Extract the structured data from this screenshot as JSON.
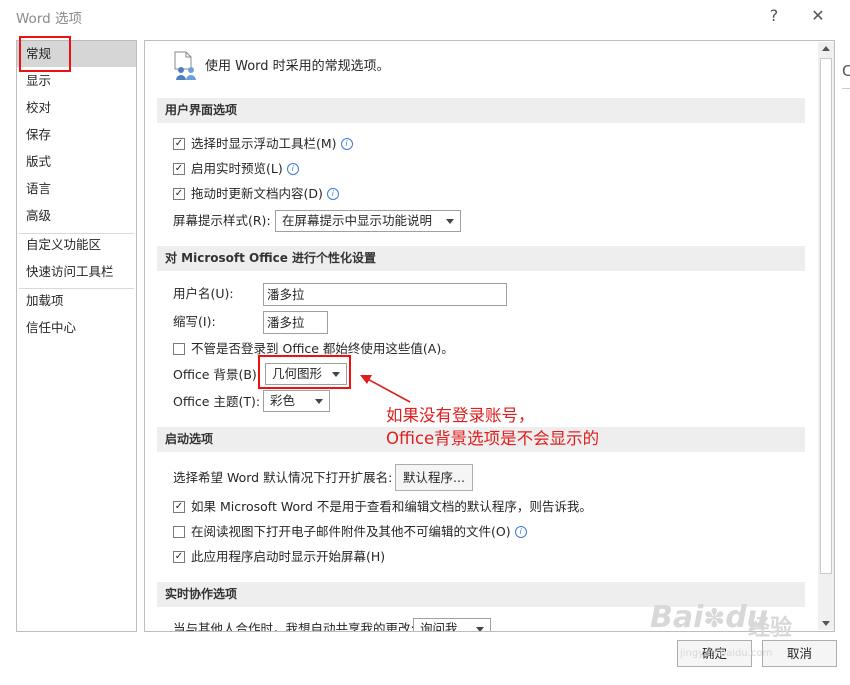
{
  "window": {
    "title": "Word 选项",
    "help_label": "?",
    "close_label": "✕"
  },
  "nav": {
    "items": [
      {
        "label": "常规"
      },
      {
        "label": "显示"
      },
      {
        "label": "校对"
      },
      {
        "label": "保存"
      },
      {
        "label": "版式"
      },
      {
        "label": "语言"
      },
      {
        "label": "高级"
      },
      {
        "label": "自定义功能区"
      },
      {
        "label": "快速访问工具栏"
      },
      {
        "label": "加载项"
      },
      {
        "label": "信任中心"
      }
    ],
    "selected": "常规"
  },
  "header": {
    "title": "使用 Word 时采用的常规选项。",
    "icon": "settings-people-icon"
  },
  "ui_options": {
    "title": "用户界面选项",
    "floating_toolbar": {
      "label": "选择时显示浮动工具栏(M)",
      "checked": true
    },
    "live_preview": {
      "label": "启用实时预览(L)",
      "checked": true
    },
    "update_drag": {
      "label": "拖动时更新文档内容(D)",
      "checked": true
    },
    "screentip_label": "屏幕提示样式(R):",
    "screentip_value": "在屏幕提示中显示功能说明"
  },
  "personalize": {
    "title": "对 Microsoft Office 进行个性化设置",
    "username_label": "用户名(U):",
    "username_value": "潘多拉",
    "initials_label": "缩写(I):",
    "initials_value": "潘多拉",
    "always_use_label": "不管是否登录到 Office 都始终使用这些值(A)。",
    "always_use_checked": false,
    "background_label": "Office 背景(B):",
    "background_value": "几何图形",
    "theme_label": "Office 主题(T):",
    "theme_value": "彩色"
  },
  "startup": {
    "title": "启动选项",
    "ext_label": "选择希望 Word 默认情况下打开扩展名:",
    "default_programs_button": "默认程序...",
    "tell_me_label": "如果 Microsoft Word 不是用于查看和编辑文档的默认程序，则告诉我。",
    "tell_me_checked": true,
    "reading_view_label": "在阅读视图下打开电子邮件附件及其他不可编辑的文件(O)",
    "reading_view_checked": false,
    "start_screen_label": "此应用程序启动时显示开始屏幕(H)",
    "start_screen_checked": true
  },
  "coauth": {
    "title": "实时协作选项",
    "share_label": "当与其他人合作时，我想自动共享我的更改:",
    "share_value": "询问我"
  },
  "annotation": {
    "line1": "如果没有登录账号，",
    "line2": "Office背景选项是不会显示的",
    "color": "#e01e1e"
  },
  "footer": {
    "ok_label": "确定",
    "cancel_label": "取消"
  },
  "watermark": {
    "brand": "Bai",
    "paw_icon": "paw-icon",
    "du": "du",
    "jingyan": "经验",
    "url": "jingyan.baidu.com"
  },
  "background_window": {
    "partial_text": "C"
  }
}
